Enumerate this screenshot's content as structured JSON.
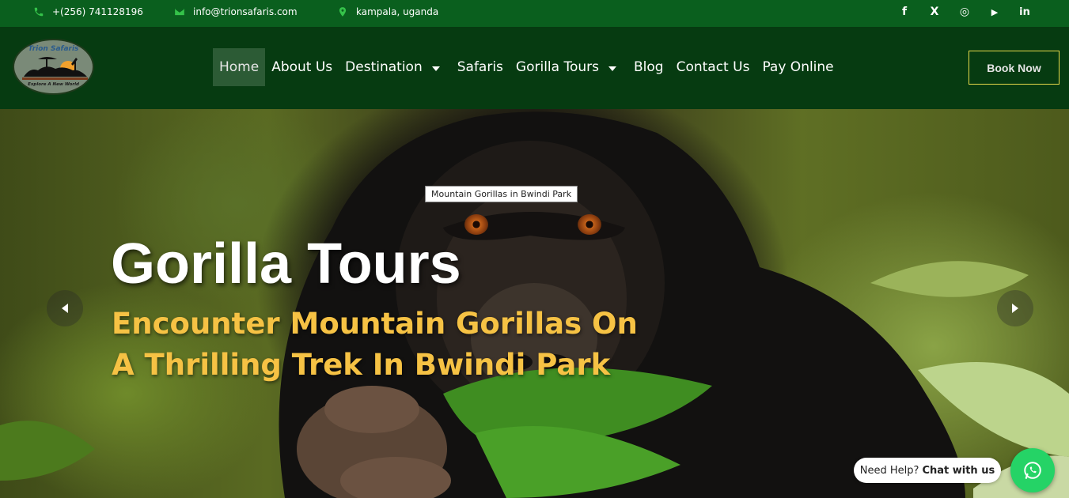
{
  "topbar": {
    "phone": "+(256) 741128196",
    "email": "info@trionsafaris.com",
    "location": "kampala, uganda",
    "social": [
      {
        "name": "facebook-icon",
        "glyph": "f"
      },
      {
        "name": "x-icon",
        "glyph": "X"
      },
      {
        "name": "instagram-icon",
        "glyph": "◎"
      },
      {
        "name": "youtube-icon",
        "glyph": "▶"
      },
      {
        "name": "linkedin-icon",
        "glyph": "in"
      }
    ]
  },
  "logo": {
    "title": "Trion Safaris",
    "tagline": "Explore A New World"
  },
  "nav": {
    "items": [
      {
        "label": "Home",
        "active": true
      },
      {
        "label": "About Us"
      },
      {
        "label": "Destination",
        "dropdown": true
      },
      {
        "label": "Safaris"
      },
      {
        "label": "Gorilla Tours",
        "dropdown": true
      },
      {
        "label": "Blog"
      },
      {
        "label": "Contact Us"
      },
      {
        "label": "Pay Online"
      }
    ],
    "book_label": "Book Now"
  },
  "hero": {
    "tooltip": "Mountain Gorillas in Bwindi Park",
    "title": "Gorilla Tours",
    "subtitle_line1": "Encounter Mountain Gorillas On",
    "subtitle_line2": "A Thrilling Trek In Bwindi Park"
  },
  "chat": {
    "prefix": "Need Help?",
    "link": "Chat with us"
  },
  "colors": {
    "topbar": "#0a5f1e",
    "header": "#063b11",
    "accent_yellow": "#f6c244",
    "whatsapp": "#25d366"
  }
}
